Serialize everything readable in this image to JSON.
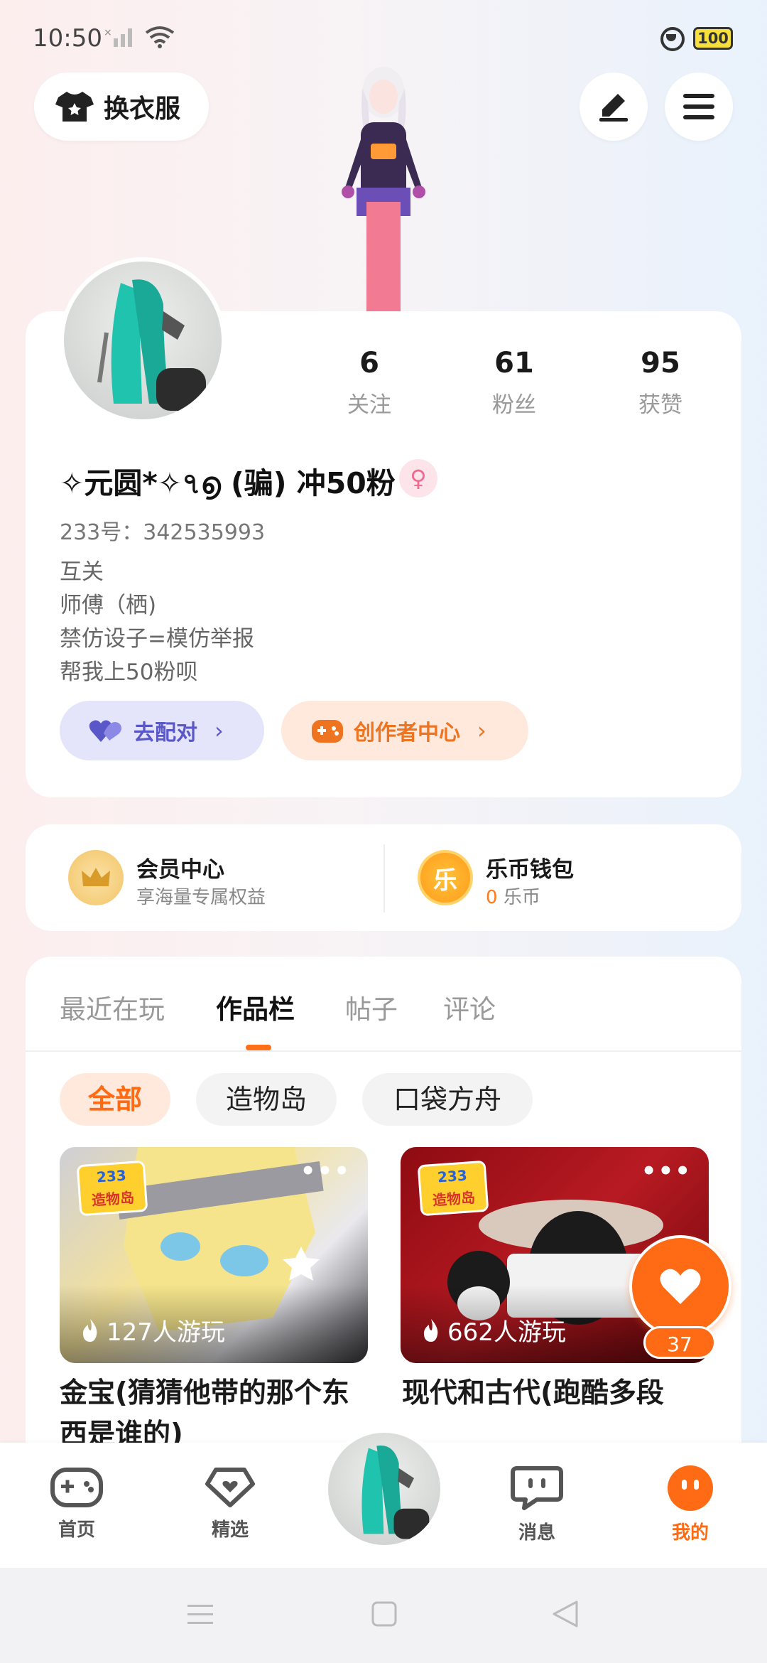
{
  "status_bar": {
    "time": "10:50",
    "battery": "100"
  },
  "top": {
    "outfit_label": "换衣服"
  },
  "profile": {
    "stats": [
      {
        "value": "6",
        "label": "关注"
      },
      {
        "value": "61",
        "label": "粉丝"
      },
      {
        "value": "95",
        "label": "获赞"
      }
    ],
    "nickname": "✧元圆*✧৭൭ (骗) 冲50粉",
    "gender_symbol": "♀",
    "uid": "233号：342535993",
    "bio": [
      "互关",
      "师傅（栖)",
      "禁仿设子=模仿举报",
      "帮我上50粉呗"
    ],
    "match_label": "去配对",
    "creator_label": "创作者中心"
  },
  "member": {
    "title": "会员中心",
    "subtitle": "享海量专属权益",
    "wallet_title": "乐币钱包",
    "wallet_amount": "0",
    "wallet_unit": "乐币",
    "coin_glyph": "乐"
  },
  "tabs": [
    "最近在玩",
    "作品栏",
    "帖子",
    "评论"
  ],
  "chips": [
    "全部",
    "造物岛",
    "口袋方舟"
  ],
  "games": [
    {
      "badge_top": "233",
      "badge_bottom": "造物岛",
      "plays": "127人游玩",
      "title": "金宝(猜猜他带的那个东西是谁的)"
    },
    {
      "badge_top": "233",
      "badge_bottom": "造物岛",
      "plays": "662人游玩",
      "title": "现代和古代(跑酷多段"
    }
  ],
  "like": {
    "count": "37"
  },
  "bottom_nav": [
    "首页",
    "精选",
    "消息",
    "我的"
  ],
  "colors": {
    "accent": "#ff6a14",
    "match": "#5a57c8",
    "creator": "#ee7420"
  }
}
